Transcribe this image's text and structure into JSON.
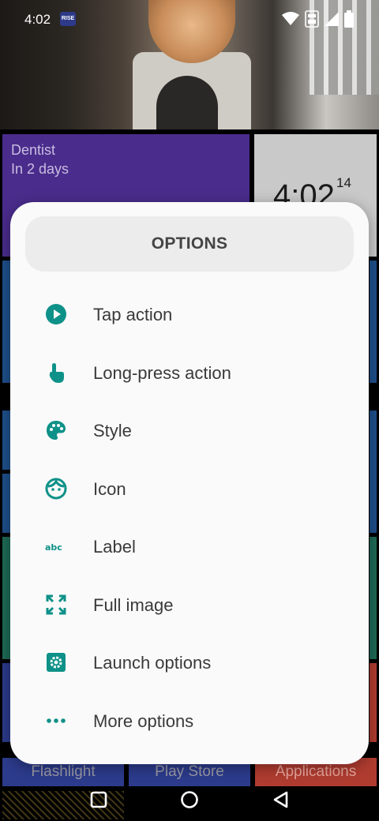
{
  "status_bar": {
    "time": "4:02",
    "badge": "RISE",
    "icons": [
      "wifi-icon",
      "volte-icon",
      "signal-icon",
      "battery-icon"
    ]
  },
  "home": {
    "dentist_tile": {
      "title": "Dentist",
      "subtitle": "In 2 days"
    },
    "clock_tile": {
      "time": "4:02",
      "seconds": "14"
    },
    "bottom_tiles": {
      "flashlight": "Flashlight",
      "play_store": "Play Store",
      "applications": "Applications"
    },
    "colors": {
      "purple": "#4a2c8c",
      "blue": "#1e4f8a",
      "green": "#1e6a56",
      "navy": "#2c3b8c",
      "red": "#b03c30"
    }
  },
  "dialog": {
    "title": "OPTIONS",
    "accent": "#0e9188",
    "options": [
      {
        "label": "Tap action",
        "icon": "play-circle-icon"
      },
      {
        "label": "Long-press action",
        "icon": "touch-hand-icon"
      },
      {
        "label": "Style",
        "icon": "palette-icon"
      },
      {
        "label": "Icon",
        "icon": "face-icon"
      },
      {
        "label": "Label",
        "icon": "abc-icon"
      },
      {
        "label": "Full image",
        "icon": "fullscreen-icon"
      },
      {
        "label": "Launch options",
        "icon": "settings-icon"
      },
      {
        "label": "More options",
        "icon": "more-horiz-icon"
      }
    ]
  },
  "nav_bar": {
    "buttons": [
      "recents-button",
      "home-button",
      "back-button"
    ]
  }
}
